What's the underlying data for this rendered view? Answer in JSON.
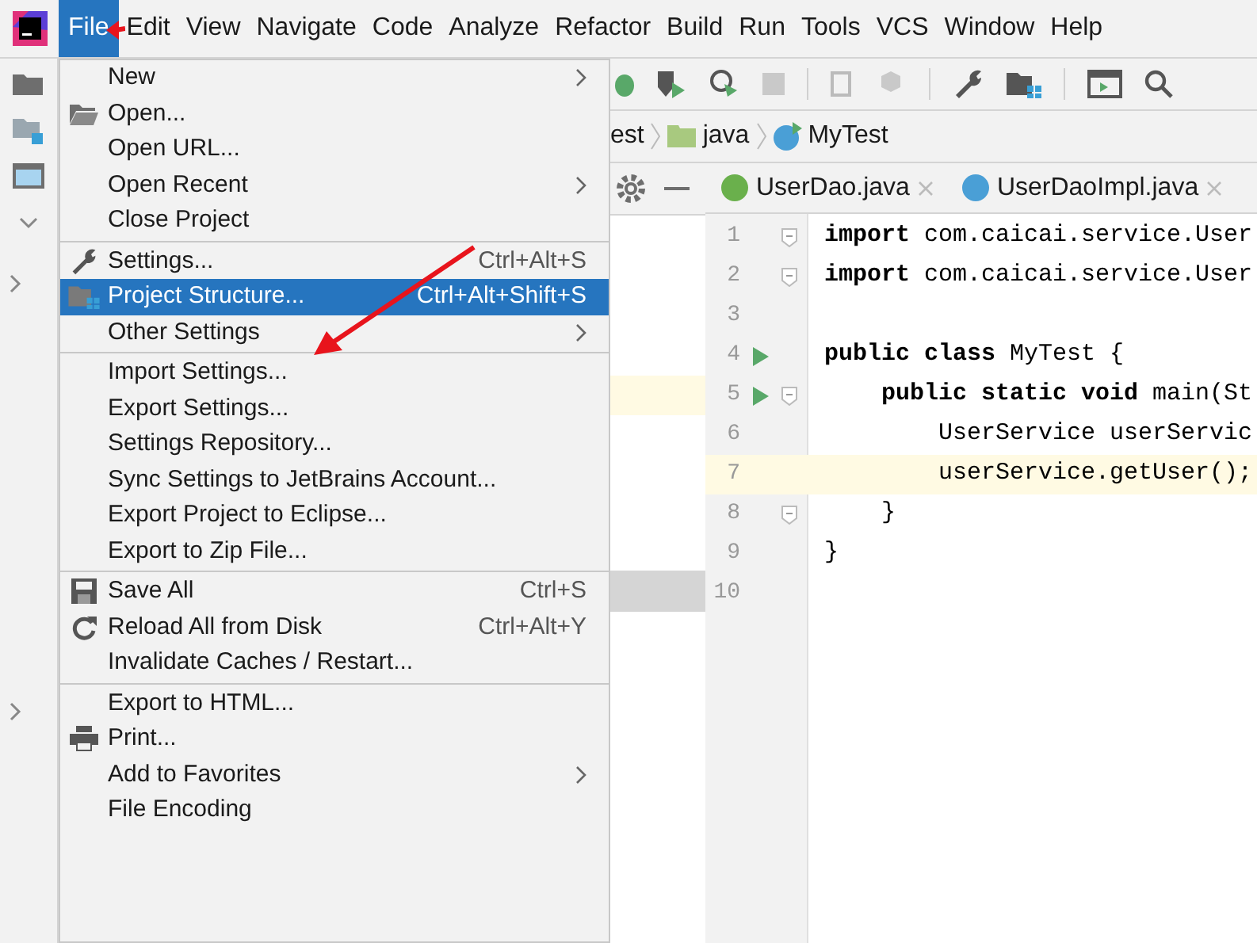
{
  "menu_bar": [
    {
      "label": "File",
      "selected": true
    },
    {
      "label": "Edit",
      "selected": false
    },
    {
      "label": "View",
      "selected": false
    },
    {
      "label": "Navigate",
      "selected": false
    },
    {
      "label": "Code",
      "selected": false
    },
    {
      "label": "Analyze",
      "selected": false
    },
    {
      "label": "Refactor",
      "selected": false
    },
    {
      "label": "Build",
      "selected": false
    },
    {
      "label": "Run",
      "selected": false
    },
    {
      "label": "Tools",
      "selected": false
    },
    {
      "label": "VCS",
      "selected": false
    },
    {
      "label": "Window",
      "selected": false
    },
    {
      "label": "Help",
      "selected": false
    }
  ],
  "breadcrumb": [
    {
      "label": "est",
      "kind": "text"
    },
    {
      "label": "java",
      "kind": "folder"
    },
    {
      "label": "MyTest",
      "kind": "class"
    }
  ],
  "editor_tabs": [
    {
      "label": "UserDao.java",
      "kind": "interface"
    },
    {
      "label": "UserDaoImpl.java",
      "kind": "class"
    }
  ],
  "code_lines": [
    {
      "number": "1",
      "text": "**import** com.caicai.service.User",
      "run": false,
      "fold": true,
      "current": false
    },
    {
      "number": "2",
      "text": "**import** com.caicai.service.User",
      "run": false,
      "fold": true,
      "current": false
    },
    {
      "number": "3",
      "run": false,
      "fold": false,
      "current": false
    },
    {
      "number": "4",
      "text": "**public class** MyTest {",
      "run": true,
      "fold": false,
      "current": false
    },
    {
      "number": "5",
      "text": "    **public static void** main(St",
      "run": true,
      "fold": true,
      "current": false
    },
    {
      "number": "6",
      "text": "        UserService userServic",
      "run": false,
      "fold": false,
      "current": false
    },
    {
      "number": "7",
      "text": "        userService.getUser();",
      "run": false,
      "fold": false,
      "current": true
    },
    {
      "number": "8",
      "text": "    }",
      "run": false,
      "fold": true,
      "current": false
    },
    {
      "number": "9",
      "text": "}",
      "run": false,
      "fold": false,
      "current": false
    },
    {
      "number": "10",
      "run": false,
      "fold": false,
      "current": false
    }
  ],
  "file_menu": [
    {
      "kind": "item",
      "label": "New",
      "submenu": true,
      "selected": false
    },
    {
      "kind": "item",
      "label": "Open...",
      "submenu": false,
      "selected": false
    },
    {
      "kind": "item",
      "label": "Open URL...",
      "submenu": false,
      "selected": false
    },
    {
      "kind": "item",
      "label": "Open Recent",
      "submenu": true,
      "selected": false
    },
    {
      "kind": "item",
      "label": "Close Project",
      "submenu": false,
      "selected": false
    },
    {
      "kind": "separator"
    },
    {
      "kind": "item",
      "label": "Settings...",
      "shortcut": "Ctrl+Alt+S",
      "submenu": false,
      "selected": false
    },
    {
      "kind": "item",
      "label": "Project Structure...",
      "shortcut": "Ctrl+Alt+Shift+S",
      "submenu": false,
      "selected": true
    },
    {
      "kind": "item",
      "label": "Other Settings",
      "submenu": true,
      "selected": false
    },
    {
      "kind": "separator"
    },
    {
      "kind": "item",
      "label": "Import Settings...",
      "submenu": false,
      "selected": false
    },
    {
      "kind": "item",
      "label": "Export Settings...",
      "submenu": false,
      "selected": false
    },
    {
      "kind": "item",
      "label": "Settings Repository...",
      "submenu": false,
      "selected": false
    },
    {
      "kind": "item",
      "label": "Sync Settings to JetBrains Account...",
      "submenu": false,
      "selected": false
    },
    {
      "kind": "item",
      "label": "Export Project to Eclipse...",
      "submenu": false,
      "selected": false
    },
    {
      "kind": "item",
      "label": "Export to Zip File...",
      "submenu": false,
      "selected": false
    },
    {
      "kind": "separator"
    },
    {
      "kind": "item",
      "label": "Save All",
      "shortcut": "Ctrl+S",
      "submenu": false,
      "selected": false
    },
    {
      "kind": "item",
      "label": "Reload All from Disk",
      "shortcut": "Ctrl+Alt+Y",
      "submenu": false,
      "selected": false
    },
    {
      "kind": "item",
      "label": "Invalidate Caches / Restart...",
      "submenu": false,
      "selected": false
    },
    {
      "kind": "separator"
    },
    {
      "kind": "item",
      "label": "Export to HTML...",
      "submenu": false,
      "selected": false
    },
    {
      "kind": "item",
      "label": "Print...",
      "submenu": false,
      "selected": false
    },
    {
      "kind": "item",
      "label": "Add to Favorites",
      "submenu": true,
      "selected": false
    },
    {
      "kind": "item",
      "label": "File Encoding",
      "submenu": false,
      "selected": false
    }
  ]
}
